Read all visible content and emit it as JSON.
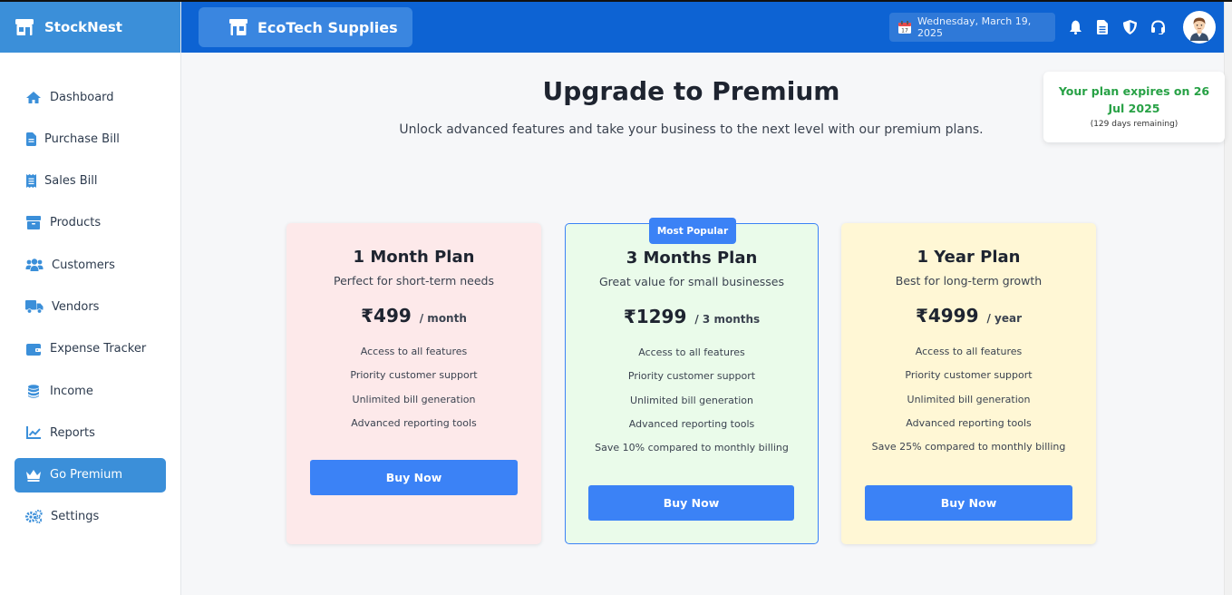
{
  "app": {
    "name": "StockNest",
    "store_name": "EcoTech Supplies"
  },
  "header": {
    "date": "Wednesday, March 19, 2025"
  },
  "sidebar": {
    "items": [
      {
        "label": "Dashboard",
        "icon": "home-icon",
        "active": false
      },
      {
        "label": "Purchase Bill",
        "icon": "file-icon",
        "active": false
      },
      {
        "label": "Sales Bill",
        "icon": "receipt-icon",
        "active": false
      },
      {
        "label": "Products",
        "icon": "box-icon",
        "active": false
      },
      {
        "label": "Customers",
        "icon": "users-icon",
        "active": false
      },
      {
        "label": "Vendors",
        "icon": "truck-icon",
        "active": false
      },
      {
        "label": "Expense Tracker",
        "icon": "wallet-icon",
        "active": false
      },
      {
        "label": "Income",
        "icon": "coins-icon",
        "active": false
      },
      {
        "label": "Reports",
        "icon": "chart-line-icon",
        "active": false
      },
      {
        "label": "Go Premium",
        "icon": "crown-icon",
        "active": true
      },
      {
        "label": "Settings",
        "icon": "gears-icon",
        "active": false
      }
    ]
  },
  "main": {
    "title": "Upgrade to Premium",
    "subtitle": "Unlock advanced features and take your business to the next level with our premium plans."
  },
  "expiry": {
    "text": "Your plan expires on 26 Jul 2025",
    "remaining": "(129 days remaining)"
  },
  "plans": [
    {
      "name": "1 Month Plan",
      "tagline": "Perfect for short-term needs",
      "price": "₹499",
      "period": "/ month",
      "features": [
        "Access to all features",
        "Priority customer support",
        "Unlimited bill generation",
        "Advanced reporting tools"
      ],
      "button": "Buy Now"
    },
    {
      "name": "3 Months Plan",
      "tagline": "Great value for small businesses",
      "price": "₹1299",
      "period": "/ 3 months",
      "badge": "Most Popular",
      "features": [
        "Access to all features",
        "Priority customer support",
        "Unlimited bill generation",
        "Advanced reporting tools",
        "Save 10% compared to monthly billing"
      ],
      "button": "Buy Now"
    },
    {
      "name": "1 Year Plan",
      "tagline": "Best for long-term growth",
      "price": "₹4999",
      "period": "/ year",
      "features": [
        "Access to all features",
        "Priority customer support",
        "Unlimited bill generation",
        "Advanced reporting tools",
        "Save 25% compared to monthly billing"
      ],
      "button": "Buy Now"
    }
  ],
  "colors": {
    "sidebar_brand": "#3b8fd9",
    "header": "#0d63d3",
    "accent": "#3b82f6",
    "expiry_text": "#27a145",
    "card_month": "#fde9ea",
    "card_quarter": "#eafbea",
    "card_year": "#fff7d5"
  }
}
